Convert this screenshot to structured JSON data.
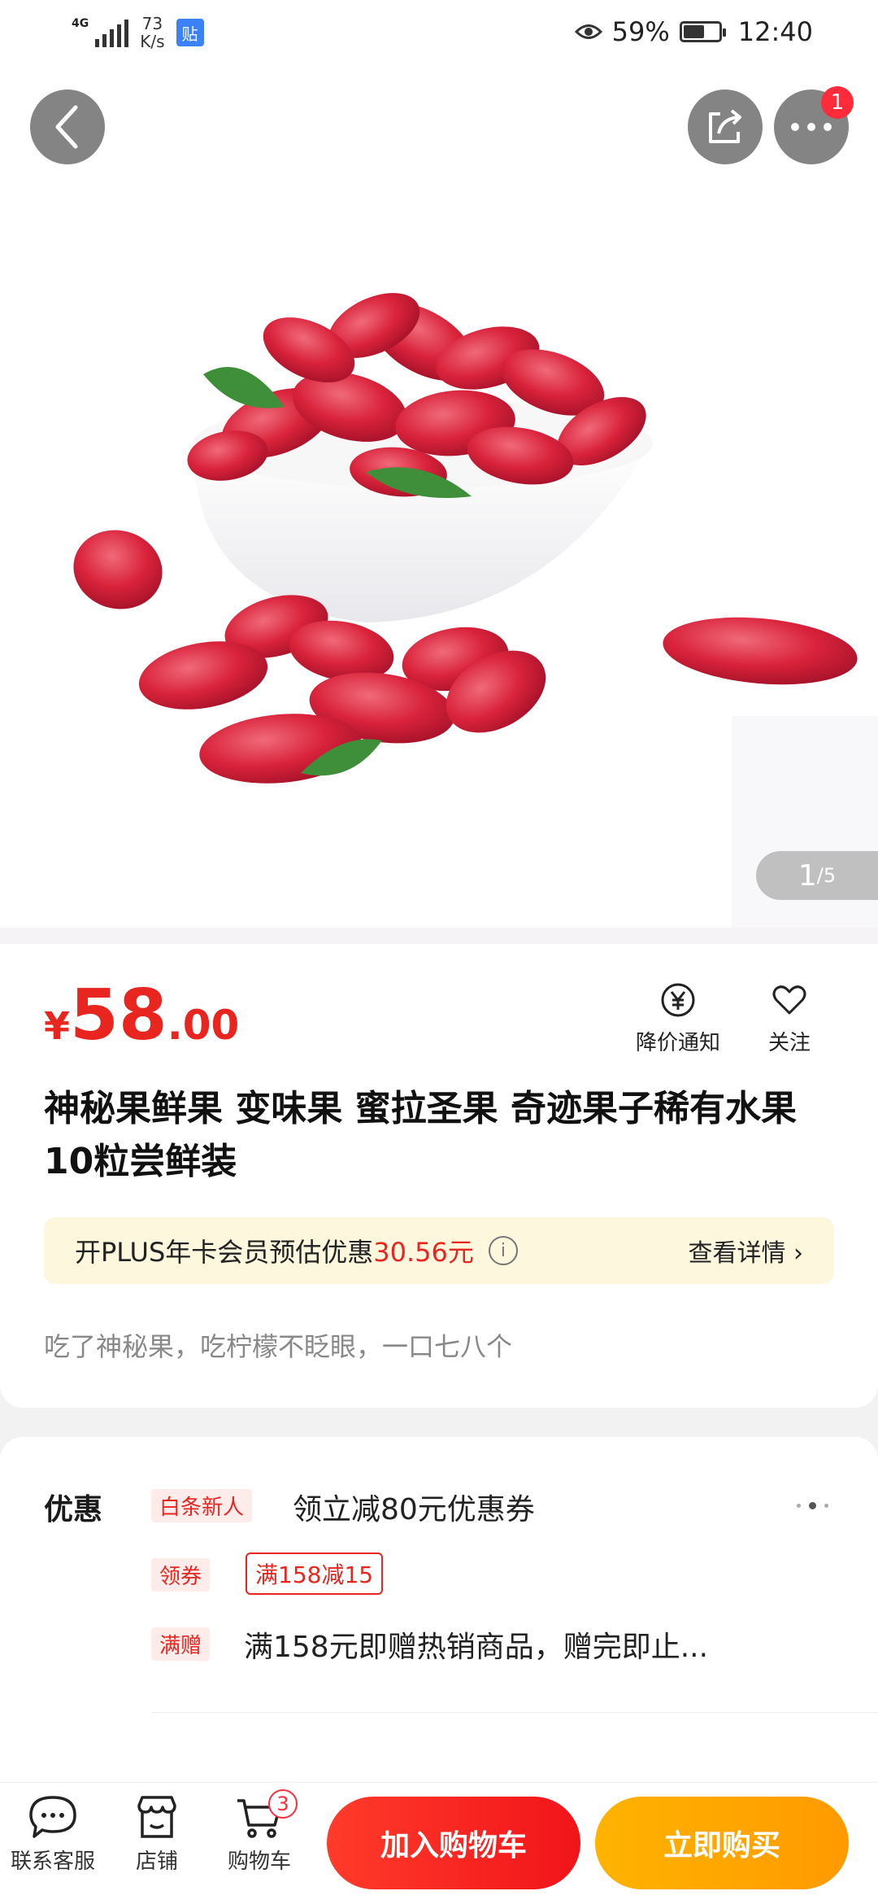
{
  "status_bar": {
    "network": "4G",
    "speed_value": "73",
    "speed_unit": "K/s",
    "notification_icon_text": "贴",
    "battery": "59%",
    "time": "12:40"
  },
  "header": {
    "more_badge": "1"
  },
  "gallery": {
    "current": "1",
    "total": "/5"
  },
  "product": {
    "price_currency": "¥",
    "price_integer": "58",
    "price_decimal": ".00",
    "price_alert_label": "降价通知",
    "follow_label": "关注",
    "title": "神秘果鲜果 变味果 蜜拉圣果 奇迹果子稀有水果 10粒尝鲜装",
    "plus_text": "开PLUS年卡会员预估优惠",
    "plus_amount": "30.56元",
    "plus_detail": "查看详情 ›",
    "subtitle": "吃了神秘果，吃柠檬不眨眼，一口七八个"
  },
  "promo": {
    "heading": "优惠",
    "row1_tag": "白条新人",
    "row1_text": "领立减80元优惠券",
    "row2_tag": "领券",
    "row2_coupon": "满158减15",
    "row3_tag": "满赠",
    "row3_text": "满158元即赠热销商品，赠完即止..."
  },
  "bottom_bar": {
    "service_label": "联系客服",
    "shop_label": "店铺",
    "cart_label": "购物车",
    "cart_badge": "3",
    "add_to_cart": "加入购物车",
    "buy_now": "立即购买"
  },
  "colors": {
    "accent_red": "#e8251f",
    "buy_orange": "#ffa500",
    "plus_bg": "#fdf7dd"
  }
}
